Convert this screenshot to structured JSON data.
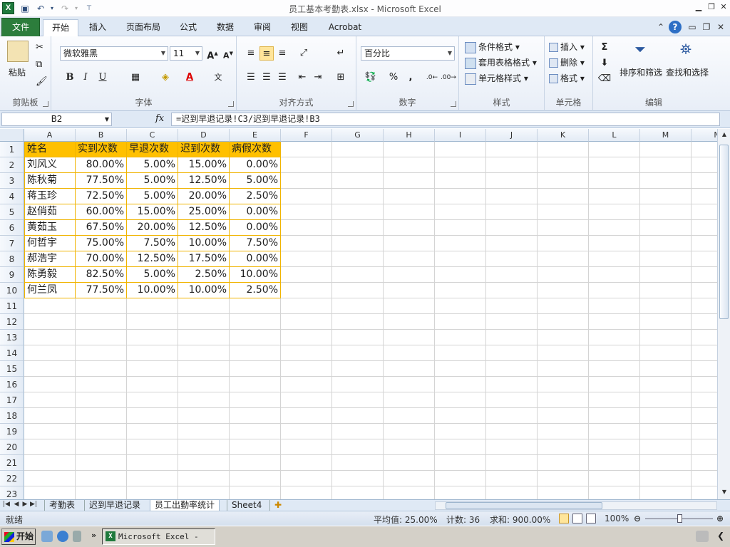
{
  "window": {
    "title": "员工基本考勤表.xlsx - Microsoft Excel",
    "app_icon": "X"
  },
  "tabs": [
    {
      "label": "文件"
    },
    {
      "label": "开始"
    },
    {
      "label": "插入"
    },
    {
      "label": "页面布局"
    },
    {
      "label": "公式"
    },
    {
      "label": "数据"
    },
    {
      "label": "审阅"
    },
    {
      "label": "视图"
    },
    {
      "label": "Acrobat"
    }
  ],
  "ribbon": {
    "clipboard": {
      "label": "剪贴板",
      "paste": "粘贴"
    },
    "font": {
      "label": "字体",
      "font_name": "微软雅黑",
      "font_size": "11",
      "bold": "B",
      "italic": "I",
      "underline": "U",
      "grow": "A",
      "shrink": "A"
    },
    "alignment": {
      "label": "对齐方式"
    },
    "number": {
      "label": "数字",
      "format": "百分比",
      "percent": "%",
      "comma": ","
    },
    "styles": {
      "label": "样式",
      "conditional": "条件格式",
      "table": "套用表格格式",
      "cell_styles": "单元格样式"
    },
    "cells": {
      "label": "单元格",
      "insert": "插入",
      "delete": "删除",
      "format": "格式"
    },
    "editing": {
      "label": "编辑",
      "sort": "排序和筛选",
      "find": "查找和选择",
      "sigma": "Σ"
    }
  },
  "formula_bar": {
    "name_box": "B2",
    "fx": "fx",
    "formula": "=迟到早退记录!C3/迟到早退记录!B3"
  },
  "columns": [
    "A",
    "B",
    "C",
    "D",
    "E",
    "F",
    "G",
    "H",
    "I",
    "J",
    "K",
    "L",
    "M",
    "N"
  ],
  "row_numbers": [
    "1",
    "2",
    "3",
    "4",
    "5",
    "6",
    "7",
    "8",
    "9",
    "10",
    "11",
    "12",
    "13",
    "14",
    "15",
    "16",
    "17",
    "18",
    "19",
    "20",
    "21",
    "22",
    "23"
  ],
  "table": {
    "headers": [
      "姓名",
      "实到次数",
      "早退次数",
      "迟到次数",
      "病假次数"
    ],
    "rows": [
      [
        "刘风义",
        "80.00%",
        "5.00%",
        "15.00%",
        "0.00%"
      ],
      [
        "陈秋菊",
        "77.50%",
        "5.00%",
        "12.50%",
        "5.00%"
      ],
      [
        "蒋玉珍",
        "72.50%",
        "5.00%",
        "20.00%",
        "2.50%"
      ],
      [
        "赵俏茹",
        "60.00%",
        "15.00%",
        "25.00%",
        "0.00%"
      ],
      [
        "黄茹玉",
        "67.50%",
        "20.00%",
        "12.50%",
        "0.00%"
      ],
      [
        "何哲宇",
        "75.00%",
        "7.50%",
        "10.00%",
        "7.50%"
      ],
      [
        "郝浩宇",
        "70.00%",
        "12.50%",
        "17.50%",
        "0.00%"
      ],
      [
        "陈勇毅",
        "82.50%",
        "5.00%",
        "2.50%",
        "10.00%"
      ],
      [
        "何兰凤",
        "77.50%",
        "10.00%",
        "10.00%",
        "2.50%"
      ]
    ]
  },
  "sheets": [
    {
      "label": "考勤表"
    },
    {
      "label": "迟到早退记录"
    },
    {
      "label": "员工出勤率统计"
    },
    {
      "label": "Sheet4"
    }
  ],
  "status": {
    "ready": "就绪",
    "average": "平均值: 25.00%",
    "count": "计数: 36",
    "sum": "求和: 900.00%",
    "zoom": "100%"
  },
  "taskbar": {
    "start": "开始",
    "item": "Microsoft Excel - ..."
  },
  "colors": {
    "header_fill": "#ffc000",
    "table_border": "#f0b400",
    "file_tab": "#2c7d3c"
  }
}
